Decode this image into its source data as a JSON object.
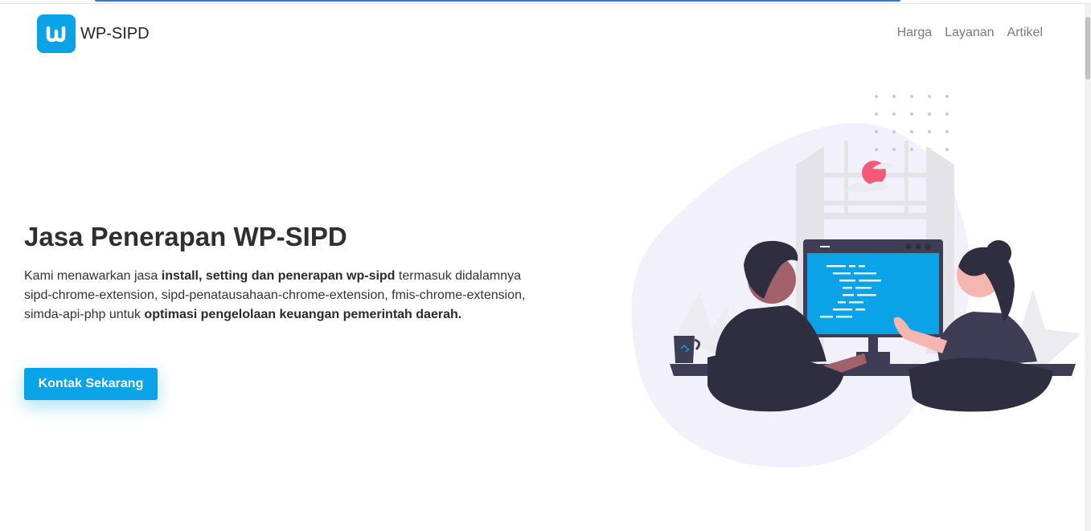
{
  "nav": {
    "brand": "WP-SIPD",
    "logo_icon": "w-logo-icon",
    "links": [
      {
        "label": "Harga"
      },
      {
        "label": "Layanan"
      },
      {
        "label": "Artikel"
      }
    ]
  },
  "hero": {
    "title": "Jasa Penerapan WP-SIPD",
    "desc": {
      "part1": "Kami menawarkan jasa ",
      "bold1": "install, setting dan penerapan wp-sipd",
      "part2": " termasuk didalamnya sipd-chrome-extension, sipd-penatausahaan-chrome-extension, fmis-chrome-extension, simda-api-php untuk ",
      "bold2": "optimasi pengelolaan keuangan pemerintah daerah."
    },
    "cta": "Kontak Sekarang"
  },
  "colors": {
    "accent": "#0aa3e8",
    "blob": "#f1f0fb",
    "dark": "#2f2e41",
    "pink": "#f35a77"
  }
}
